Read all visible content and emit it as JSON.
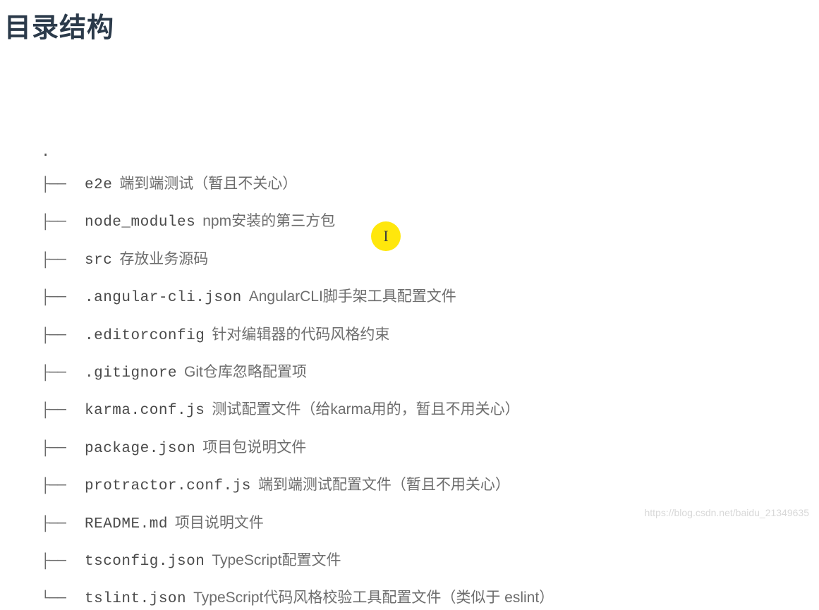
{
  "heading": "目录结构",
  "root": ".",
  "rows": [
    {
      "branch": "├──",
      "name": "e2e",
      "desc": "端到端测试（暂且不关心）"
    },
    {
      "branch": "├──",
      "name": "node_modules",
      "desc": "npm安装的第三方包"
    },
    {
      "branch": "├──",
      "name": "src",
      "desc": "存放业务源码"
    },
    {
      "branch": "├──",
      "name": ".angular-cli.json",
      "desc": "AngularCLI脚手架工具配置文件"
    },
    {
      "branch": "├──",
      "name": ".editorconfig",
      "desc": "针对编辑器的代码风格约束"
    },
    {
      "branch": "├──",
      "name": ".gitignore",
      "desc": "Git仓库忽略配置项"
    },
    {
      "branch": "├──",
      "name": "karma.conf.js",
      "desc": "测试配置文件（给karma用的，暂且不用关心）"
    },
    {
      "branch": "├──",
      "name": "package.json",
      "desc": "项目包说明文件"
    },
    {
      "branch": "├──",
      "name": "protractor.conf.js",
      "desc": "端到端测试配置文件（暂且不用关心）"
    },
    {
      "branch": "├──",
      "name": "README.md",
      "desc": "项目说明文件"
    },
    {
      "branch": "├──",
      "name": "tsconfig.json",
      "desc": "TypeScript配置文件"
    },
    {
      "branch": "└──",
      "name": "tslint.json",
      "desc": "TypeScript代码风格校验工具配置文件（类似于 eslint）"
    }
  ],
  "watermark": "https://blog.csdn.net/baidu_21349635"
}
